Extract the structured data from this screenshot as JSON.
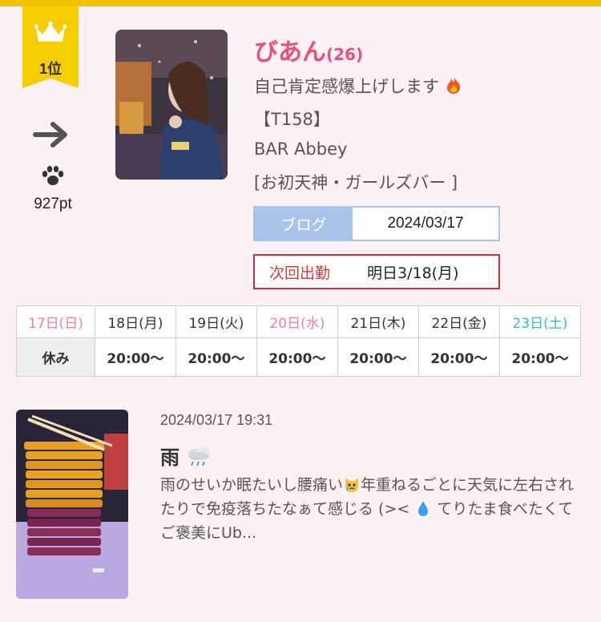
{
  "ranking": {
    "rank": "1位",
    "trend_icon": "arrow-right-icon",
    "points_icon": "paw-icon",
    "points": "927pt"
  },
  "profile": {
    "name": "びあん",
    "age": "(26)",
    "catchphrase": "自己肯定感爆上げします",
    "height": "【T158】",
    "shop": "BAR Abbey",
    "area_genre": "[お初天神・ガールズバー ]"
  },
  "blog": {
    "label": "ブログ",
    "date": "2024/03/17"
  },
  "next_shift": {
    "label": "次回出勤",
    "value": "明日3/18(月)"
  },
  "schedule": {
    "days": [
      "17日(日)",
      "18日(月)",
      "19日(火)",
      "20日(水)",
      "21日(木)",
      "22日(金)",
      "23日(土)"
    ],
    "times": [
      "休み",
      "20:00〜",
      "20:00〜",
      "20:00〜",
      "20:00〜",
      "20:00〜",
      "20:00〜"
    ]
  },
  "post": {
    "datetime": "2024/03/17 19:31",
    "title": "雨",
    "body_1": "雨のせいか眠たいし腰痛い",
    "body_2": "年重ねるごとに天気に左右されたりで免疫落ちたなぁて感じる (>< ",
    "body_3": " てりたま食べたくてご褒美にUb..."
  },
  "colors": {
    "accent_pink": "#e8507a",
    "rank_gold": "#f5cd00",
    "blog_blue": "#a9c3e9",
    "shift_red": "#c8303a",
    "sunday_pink": "#f07aa8",
    "saturday_teal": "#3bb7c9"
  }
}
